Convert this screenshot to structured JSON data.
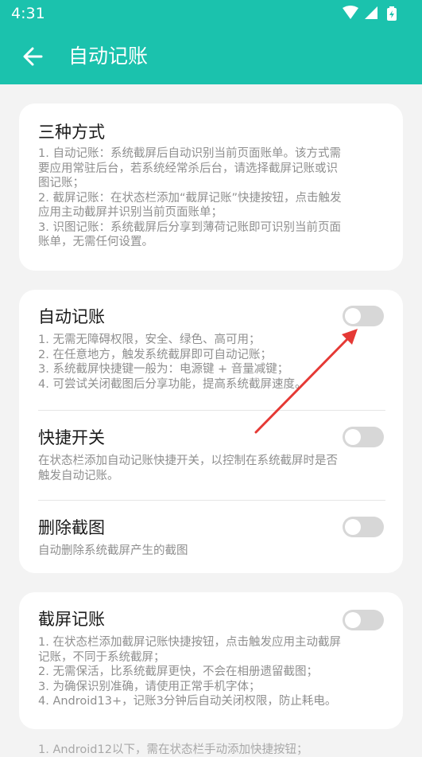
{
  "status": {
    "time": "4:31"
  },
  "header": {
    "title": "自动记账"
  },
  "intro": {
    "title": "三种方式",
    "lines": [
      "1. 自动记账：系统截屏后自动识别当前页面账单。该方式需",
      "要应用常驻后台，若系统经常杀后台，请选择截屏记账或识",
      "图记账；",
      "2. 截屏记账：在状态栏添加“截屏记账”快捷按钮，点击触发",
      "应用主动截屏并识别当前页面账单；",
      "3. 识图记账：系统截屏后分享到薄荷记账即可识别当前页面",
      "账单，无需任何设置。"
    ]
  },
  "auto": {
    "title": "自动记账",
    "toggle": "off",
    "lines": [
      "1. 无需无障碍权限，安全、绿色、高可用；",
      "2. 在任意地方，触发系统截屏即可自动记账；",
      "3. 系统截屏快捷键一般为：电源键 + 音量减键；",
      "4. 可尝试关闭截图后分享功能，提高系统截屏速度。"
    ]
  },
  "shortcut": {
    "title": "快捷开关",
    "toggle": "off",
    "lines": [
      "在状态栏添加自动记账快捷开关，以控制在系统截屏时是否",
      "触发自动记账。"
    ]
  },
  "delete": {
    "title": "删除截图",
    "toggle": "off",
    "lines": [
      "自动删除系统截屏产生的截图"
    ]
  },
  "screenshot": {
    "title": "截屏记账",
    "toggle": "off",
    "lines": [
      "1. 在状态栏添加截屏记账快捷按钮，点击触发应用主动截屏",
      "记账，不同于系统截屏；",
      "2. 无需保活，比系统截屏更快，不会在相册遗留截图；",
      "3. 为确保识别准确，请使用正常手机字体；",
      "4. Android13+，记账3分钟后自动关闭权限，防止耗电。"
    ]
  },
  "footer": {
    "note": "1. Android12以下，需在状态栏手动添加快捷按钮；"
  },
  "colors": {
    "accent": "#1bc2ad",
    "annotation_arrow": "#e53935",
    "switch_off": "#d7d7d7"
  },
  "icons": {
    "back": "arrow-left-icon",
    "wifi": "wifi-icon",
    "signal": "signal-icon",
    "battery": "battery-charging-icon"
  }
}
